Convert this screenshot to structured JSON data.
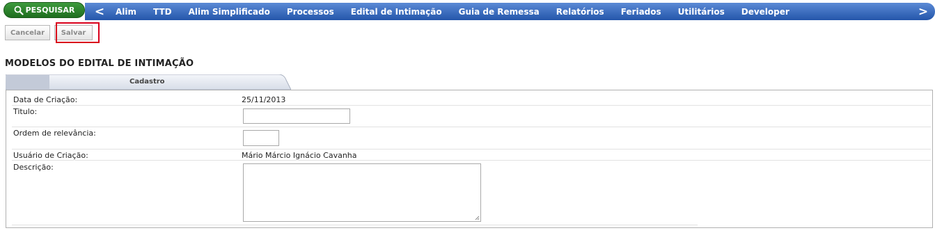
{
  "topbar": {
    "search_label": "PESQUISAR",
    "nav_prev_icon": "chevron-left-icon",
    "nav_next_icon": "chevron-right-icon",
    "nav_prev": "<",
    "nav_next": ">",
    "menu": [
      "Alim",
      "TTD",
      "Alim Simplificado",
      "Processos",
      "Edital de Intimação",
      "Guia de Remessa",
      "Relatórios",
      "Feriados",
      "Utilitários",
      "Developer"
    ]
  },
  "toolbar": {
    "cancel_label": "Cancelar",
    "save_label": "Salvar"
  },
  "page_title": "MODELOS DO EDITAL DE INTIMAÇÃO",
  "tab": {
    "label": "Cadastro"
  },
  "form": {
    "data_criacao_label": "Data de Criação:",
    "data_criacao_value": "25/11/2013",
    "titulo_label": "Titulo:",
    "titulo_value": "",
    "ordem_label": "Ordem de relevância:",
    "ordem_value": "",
    "usuario_label": "Usuário de Criação:",
    "usuario_value": "Mário Márcio Ignácio Cavanha",
    "descricao_label": "Descrição:",
    "descricao_value": ""
  },
  "colors": {
    "nav_blue": "#2f62b8",
    "search_green": "#2a7f2a",
    "highlight_red": "#d9001b"
  }
}
